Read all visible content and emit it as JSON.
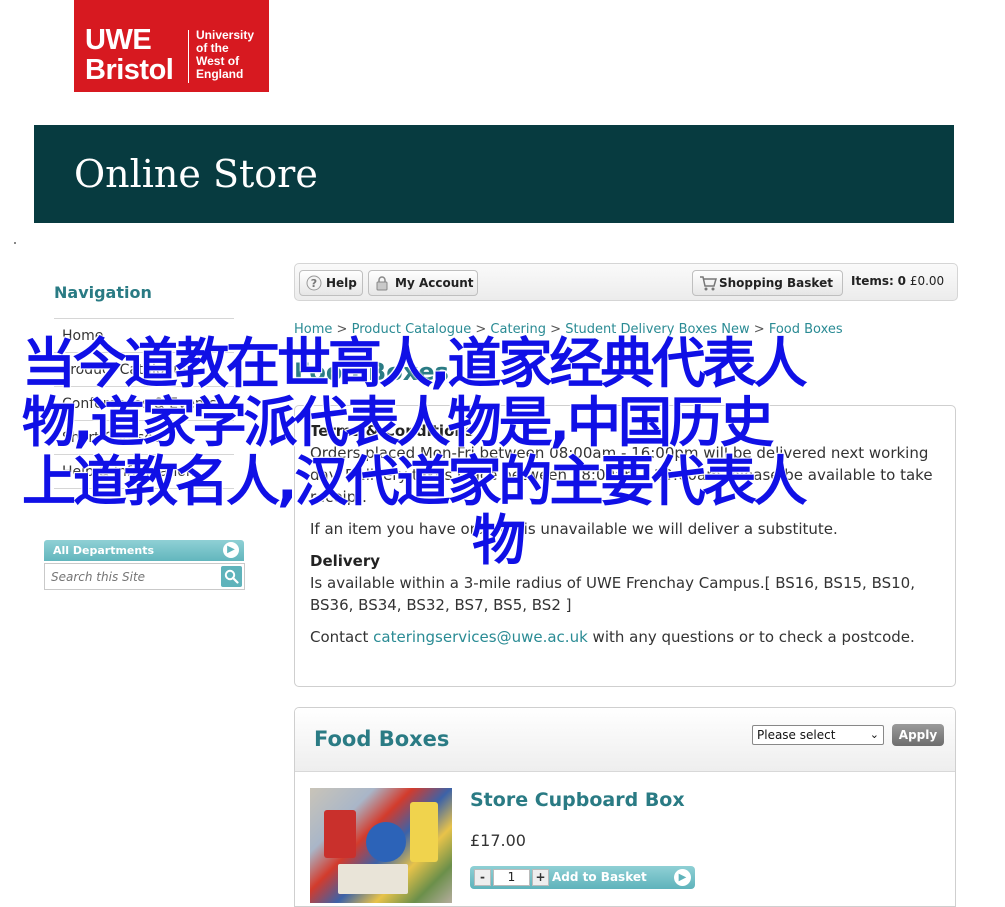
{
  "logo": {
    "line1": "UWE",
    "line2": "Bristol",
    "uni_lines": [
      "University",
      "of the",
      "West of",
      "England"
    ]
  },
  "banner": {
    "title": "Online Store"
  },
  "sidebar": {
    "title": "Navigation",
    "items": [
      "Home",
      "Product Catalogue",
      "Conferences & Events",
      "Short Courses",
      "Help & Information"
    ],
    "departments": "All Departments",
    "search_placeholder": "Search this Site"
  },
  "toolbar": {
    "help": "Help",
    "account": "My Account",
    "basket": "Shopping Basket",
    "items_label": "Items:",
    "items_count": "0",
    "total": "£0.00"
  },
  "breadcrumb": {
    "items": [
      "Home",
      "Product Catalogue",
      "Catering",
      "Student Delivery Boxes New",
      "Food Boxes"
    ],
    "separator": ">"
  },
  "page_title": "Food Boxes",
  "terms": {
    "heading": "Terms & Conditions",
    "p1": "Orders placed Mon-Fri between 08:00am - 16:00pm will be delivered next working day. Delivery takes place between 08:00am - 10:00am, please be available to take receipt.",
    "p2": "If an item you have ordered is unavailable we will deliver a substitute.",
    "delivery_heading": "Delivery",
    "p3": "Is available within a 3-mile radius of UWE Frenchay Campus.[ BS16, BS15, BS10, BS36, BS34, BS32, BS7, BS5, BS2 ]",
    "contact_prefix": "Contact ",
    "contact_email": "cateringservices@uwe.ac.uk",
    "contact_suffix": " with any questions or to check a postcode."
  },
  "food_boxes": {
    "title": "Food Boxes",
    "select_value": "Please select",
    "apply": "Apply",
    "product": {
      "name": "Store Cupboard Box",
      "price": "£17.00",
      "qty": "1",
      "add_label": "Add to Basket"
    }
  },
  "overlay": {
    "lines": [
      "当今道教在世高人,道家经典代表人",
      "物,道家学派代表人物是,中国历史",
      "上道教名人,汉代道家的主要代表人",
      "物"
    ]
  },
  "colors": {
    "brand_red": "#d71920",
    "banner_teal": "#073b40",
    "accent_teal": "#2a7b84",
    "overlay_blue": "#1010e6"
  }
}
